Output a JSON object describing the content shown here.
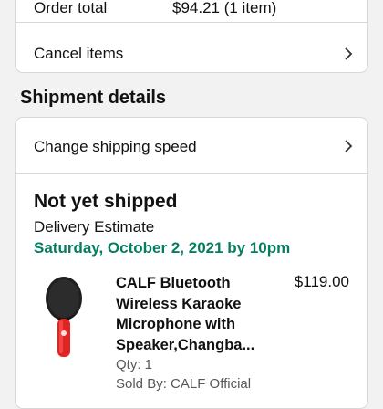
{
  "order_summary": {
    "label": "Order total",
    "value": "$94.21 (1 item)",
    "cancel_label": "Cancel items"
  },
  "shipment": {
    "section_title": "Shipment details",
    "change_speed_label": "Change shipping speed",
    "status": "Not yet shipped",
    "estimate_label": "Delivery Estimate",
    "estimate_date": "Saturday, October 2, 2021 by 10pm",
    "product": {
      "title": "CALF Bluetooth Wireless Karaoke Microphone with Speaker,Changba...",
      "price": "$119.00",
      "qty": "Qty: 1",
      "sold_by": "Sold By: CALF Official"
    }
  },
  "colors": {
    "accent_green": "#067d62",
    "border": "#d5d9d9",
    "background": "#f2f2f2"
  },
  "icons": {
    "chevron": "chevron-right-icon",
    "product": "microphone-product-image"
  }
}
